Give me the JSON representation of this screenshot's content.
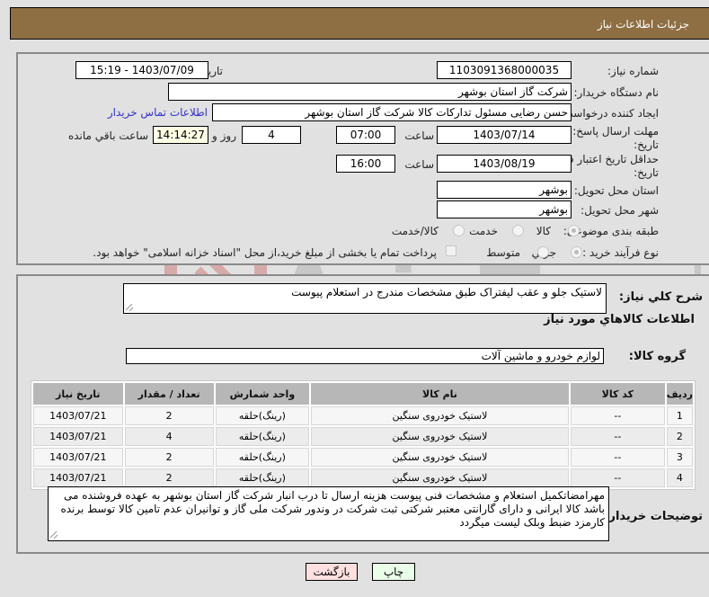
{
  "header": {
    "title": "جزئیات اطلاعات نیاز"
  },
  "form": {
    "need_number": {
      "label": "شماره نیاز:",
      "value": "1103091368000035"
    },
    "announce_datetime": {
      "label": "تاریخ و ساعت اعلان عمومي:",
      "value": "1403/07/09 - 15:19"
    },
    "buyer_org": {
      "label": "نام دستگاه خریدار:",
      "value": "شرکت گاز استان بوشهر"
    },
    "requester": {
      "label": "ایجاد کننده درخواست:",
      "value": "حسن رضایی مسئول تدارکات کالا شرکت گاز استان بوشهر"
    },
    "buyer_contact_link": "اطلاعات تماس خریدار",
    "reply_deadline": {
      "label": "مهلت ارسال پاسخ: تا تاریخ:",
      "date": "1403/07/14",
      "time_label": "ساعت",
      "time": "07:00",
      "days": "4",
      "days_label": "روز و",
      "remaining": "14:14:27",
      "remaining_label": "ساعت باقي مانده"
    },
    "price_validity": {
      "label": "حداقل تاریخ اعتبار قیمت: تا تاریخ:",
      "date": "1403/08/19",
      "time_label": "ساعت",
      "time": "16:00"
    },
    "delivery_province": {
      "label": "استان محل تحویل:",
      "value": "بوشهر"
    },
    "delivery_city": {
      "label": "شهر محل تحویل:",
      "value": "بوشهر"
    },
    "category": {
      "label": "طبقه بندی موضوعی:",
      "options": [
        "کالا",
        "خدمت",
        "کالا/خدمت"
      ],
      "selected": "کالا"
    },
    "purchase_type": {
      "label": "نوع فرآیند خرید :",
      "options": [
        "جزیي",
        "متوسط"
      ],
      "selected": "جزیي",
      "treasury_note": "پرداخت تمام یا بخشی از مبلغ خرید،از محل \"اسناد خزانه اسلامی\" خواهد بود.",
      "treasury_checked": false
    }
  },
  "details": {
    "general_desc_label": "شرح کلي نیاز:",
    "general_desc": "لاستیک جلو و عقب لیفتراک طبق مشخصات مندرج در استعلام پیوست",
    "items_section_title": "اطلاعات کالاهاي مورد نیاز",
    "goods_group_label": "گروه کالا:",
    "goods_group": "لوازم خودرو و ماشین آلات",
    "table": {
      "headers": [
        "ردیف",
        "کد کالا",
        "نام کالا",
        "واحد شمارش",
        "تعداد / مقدار",
        "تاریخ نیاز"
      ],
      "rows": [
        [
          "1",
          "--",
          "لاستیک خودروی سنگین",
          "(رینگ)حلقه",
          "2",
          "1403/07/21"
        ],
        [
          "2",
          "--",
          "لاستیک خودروی سنگین",
          "(رینگ)حلقه",
          "4",
          "1403/07/21"
        ],
        [
          "3",
          "--",
          "لاستیک خودروی سنگین",
          "(رینگ)حلقه",
          "2",
          "1403/07/21"
        ],
        [
          "4",
          "--",
          "لاستیک خودروی سنگین",
          "(رینگ)حلقه",
          "2",
          "1403/07/21"
        ]
      ]
    },
    "buyer_notes_label": "توضیحات خریدار:",
    "buyer_notes": "مهرامضاتکمیل استعلام و مشخصات فنی پیوست هزینه ارسال تا درب انبار شرکت گاز استان بوشهر به عهده فروشنده می باشد کالا ایرانی و دارای گارانتی معتبر شرکتی ثبت شرکت در وندور شرکت ملی گاز و توانیران عدم تامین کالا توسط برنده کارمزد ضبط وبلک لیست میگردد"
  },
  "buttons": {
    "print": "چاپ",
    "back": "بازگشت"
  },
  "watermark": {
    "text": "AriaTender.neT"
  },
  "colors": {
    "header_bg": "#8e6e43",
    "link": "#3333cc",
    "print_bg": "#eaffea",
    "back_bg": "#ffe0e0"
  }
}
